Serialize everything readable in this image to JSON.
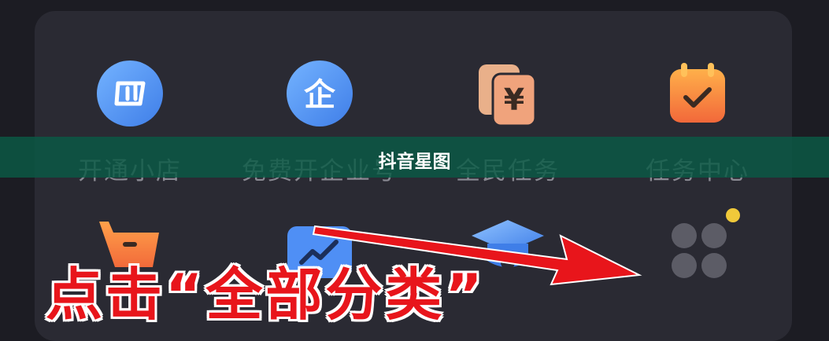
{
  "grid": {
    "row1": [
      {
        "label": "开通小店",
        "icon": "shop-icon"
      },
      {
        "label": "免费开企业号",
        "icon": "enterprise-icon"
      },
      {
        "label": "全民任务",
        "icon": "yuan-cards-icon"
      },
      {
        "label": "任务中心",
        "icon": "calendar-check-icon"
      }
    ],
    "row2": [
      {
        "label": "",
        "icon": "shopping-cart-icon"
      },
      {
        "label": "",
        "icon": "data-chart-icon"
      },
      {
        "label": "",
        "icon": "graduation-cap-icon"
      },
      {
        "label": "",
        "icon": "four-dots-icon"
      }
    ],
    "enterprise_glyph": "企",
    "yuan_glyph": "¥"
  },
  "banner": {
    "title": "抖音星图"
  },
  "annotation": {
    "text": "点击“全部分类”",
    "color": "#e8151b"
  },
  "colors": {
    "accent_blue": "#4f8ff5",
    "accent_orange": "#f5873a",
    "notify_dot": "#f0c93a"
  }
}
